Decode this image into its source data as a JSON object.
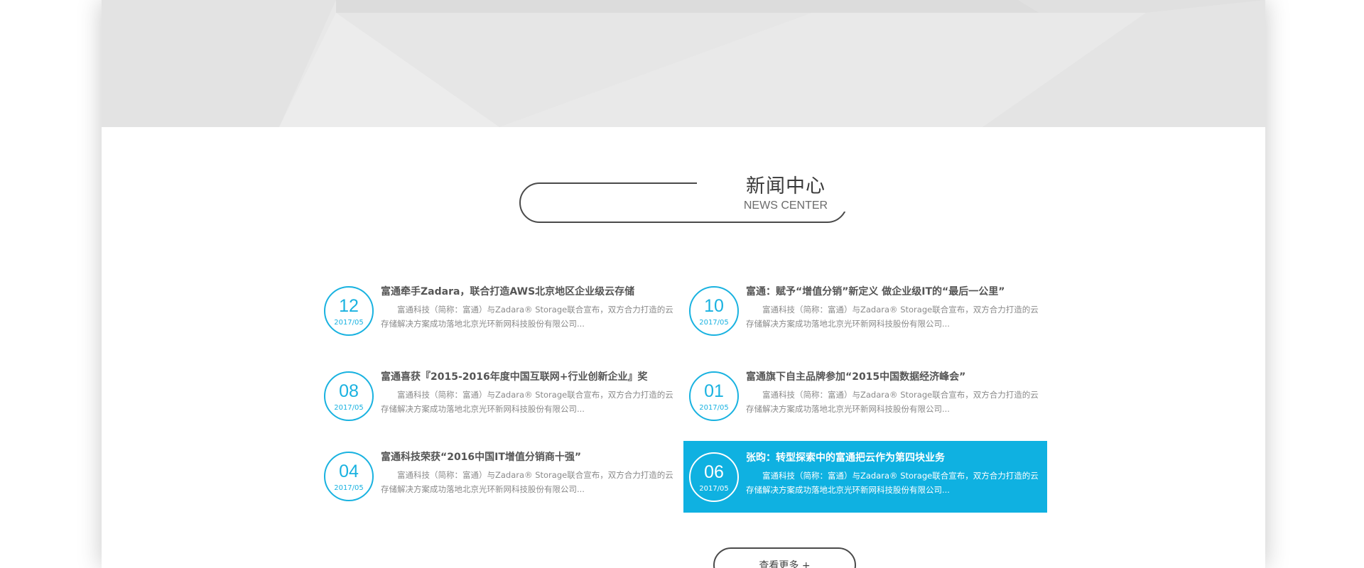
{
  "theme": {
    "accent": "#0fb1e1",
    "border": "#4a4a4a",
    "banner_bg": "#e8e8e8"
  },
  "section": {
    "title_cn": "新闻中心",
    "title_en": "NEWS CENTER"
  },
  "news": [
    {
      "day": "12",
      "ym": "2017/05",
      "title": "富通牵手Zadara，联合打造AWS北京地区企业级云存储",
      "desc": "富通科技（简称：富通）与Zadara® Storage联合宣布，双方合力打造的云存储解决方案成功落地北京光环新网科技股份有限公司..."
    },
    {
      "day": "10",
      "ym": "2017/05",
      "title": "富通：赋予“增值分销”新定义 做企业级IT的“最后一公里”",
      "desc": "富通科技（简称：富通）与Zadara® Storage联合宣布，双方合力打造的云存储解决方案成功落地北京光环新网科技股份有限公司..."
    },
    {
      "day": "08",
      "ym": "2017/05",
      "title": "富通喜获『2015-2016年度中国互联网+行业创新企业』奖",
      "desc": "富通科技（简称：富通）与Zadara® Storage联合宣布，双方合力打造的云存储解决方案成功落地北京光环新网科技股份有限公司..."
    },
    {
      "day": "01",
      "ym": "2017/05",
      "title": "富通旗下自主品牌参加“2015中国数据经济峰会”",
      "desc": "富通科技（简称：富通）与Zadara® Storage联合宣布，双方合力打造的云存储解决方案成功落地北京光环新网科技股份有限公司..."
    },
    {
      "day": "04",
      "ym": "2017/05",
      "title": "富通科技荣获“2016中国IT增值分销商十强”",
      "desc": "富通科技（简称：富通）与Zadara® Storage联合宣布，双方合力打造的云存储解决方案成功落地北京光环新网科技股份有限公司..."
    },
    {
      "day": "06",
      "ym": "2017/05",
      "title": "张昀：转型探索中的富通把云作为第四块业务",
      "desc": "富通科技（简称：富通）与Zadara® Storage联合宣布，双方合力打造的云存储解决方案成功落地北京光环新网科技股份有限公司..."
    }
  ],
  "more_button": {
    "label": "查看更多 +"
  }
}
